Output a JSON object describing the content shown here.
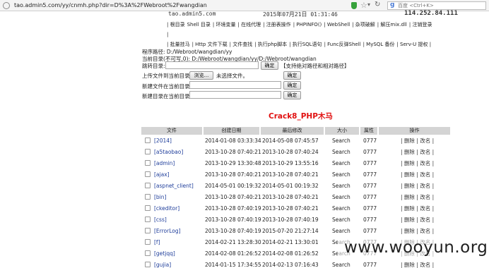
{
  "browser": {
    "url": "tao.admin5.com/yy/cnmh.php?dir=D%3A%2FWebroot%2Fwangdian",
    "search_placeholder": "百度 <Ctrl+K>",
    "icons": [
      "globe-icon",
      "shield-icon",
      "star-icon",
      "chevron-down-icon",
      "reload-icon",
      "search-engine-icon"
    ]
  },
  "header": {
    "host": "tao.admin5.com",
    "datetime": "2015年07月21日 01:31:46",
    "ip": "114.252.84.111"
  },
  "menu": [
    "| 根目录",
    "Shell 目录",
    "| 环境变量",
    "| 在线代理",
    "| 注册表操作",
    "| PHPINFO()",
    "| WebShell",
    "| 杂项破解",
    "| 解压mix.dll",
    "| 注销登录 |",
    "| 批量挂马",
    "| Http 文件下载",
    "| 文件查找",
    "| 执行php脚本",
    "| 执行SQL语句",
    "| Func反弹Shell",
    "| MySQL 备份",
    "| Serv-U 提权 |"
  ],
  "paths": {
    "program_path": "程序路径: D:/Webroot/wangdian/yy",
    "current_dir": "当前目录(不可写,0): D:/Webroot/wangdian/yy/D:/Webroot/wangdian",
    "goto_label": "跳转目录:",
    "goto_button": "确定",
    "goto_hint": "【支持绝对路径和相对路径】",
    "upload_label": "上传文件到当前目录:",
    "browse_button": "浏览...",
    "no_file": "未选择文件。",
    "upload_button": "确定",
    "newfile_label": "新建文件在当前目录:",
    "newfile_button": "确定",
    "newdir_label": "新建目录在当前目录:",
    "newdir_button": "确定"
  },
  "title": "Crack8_PHP木马",
  "table": {
    "headers": [
      "文件",
      "创建日期",
      "最后修改",
      "大小",
      "属性",
      "操作"
    ],
    "rows": [
      {
        "name": "[2014]",
        "created": "2014-01-08 03:33:34",
        "modified": "2014-05-08 07:45:57",
        "size": "Search",
        "perm": "0777",
        "ops": "| 删除 | 改名 |"
      },
      {
        "name": "[a5taobao]",
        "created": "2013-10-28 07:40:21",
        "modified": "2013-10-28 07:40:24",
        "size": "Search",
        "perm": "0777",
        "ops": "| 删除 | 改名 |"
      },
      {
        "name": "[admin]",
        "created": "2013-10-29 13:30:48",
        "modified": "2013-10-29 13:55:16",
        "size": "Search",
        "perm": "0777",
        "ops": "| 删除 | 改名 |"
      },
      {
        "name": "[ajax]",
        "created": "2013-10-28 07:40:21",
        "modified": "2013-10-28 07:40:21",
        "size": "Search",
        "perm": "0777",
        "ops": "| 删除 | 改名 |"
      },
      {
        "name": "[aspnet_client]",
        "created": "2014-05-01 00:19:32",
        "modified": "2014-05-01 00:19:32",
        "size": "Search",
        "perm": "0777",
        "ops": "| 删除 | 改名 |"
      },
      {
        "name": "[bin]",
        "created": "2013-10-28 07:40:21",
        "modified": "2013-10-28 07:40:21",
        "size": "Search",
        "perm": "0777",
        "ops": "| 删除 | 改名 |"
      },
      {
        "name": "[ckeditor]",
        "created": "2013-10-28 07:40:19",
        "modified": "2013-10-28 07:40:21",
        "size": "Search",
        "perm": "0777",
        "ops": "| 删除 | 改名 |"
      },
      {
        "name": "[css]",
        "created": "2013-10-28 07:40:19",
        "modified": "2013-10-28 07:40:19",
        "size": "Search",
        "perm": "0777",
        "ops": "| 删除 | 改名 |"
      },
      {
        "name": "[ErrorLog]",
        "created": "2013-10-28 07:40:19",
        "modified": "2015-07-20 21:27:14",
        "size": "Search",
        "perm": "0777",
        "ops": "| 删除 | 改名 |"
      },
      {
        "name": "[f]",
        "created": "2014-02-21 13:28:30",
        "modified": "2014-02-21 13:30:01",
        "size": "Search",
        "perm": "0777",
        "ops": "| 删除 | 改名 |"
      },
      {
        "name": "[getjqq]",
        "created": "2014-02-08 01:26:52",
        "modified": "2014-02-08 01:26:52",
        "size": "Search",
        "perm": "0777",
        "ops": "| 删除 | 改名 |"
      },
      {
        "name": "[gujia]",
        "created": "2014-01-15 17:34:55",
        "modified": "2014-02-13 07:16:43",
        "size": "Search",
        "perm": "0777",
        "ops": "| 删除 | 改名 |"
      }
    ]
  },
  "watermark": "www.wooyun.org"
}
